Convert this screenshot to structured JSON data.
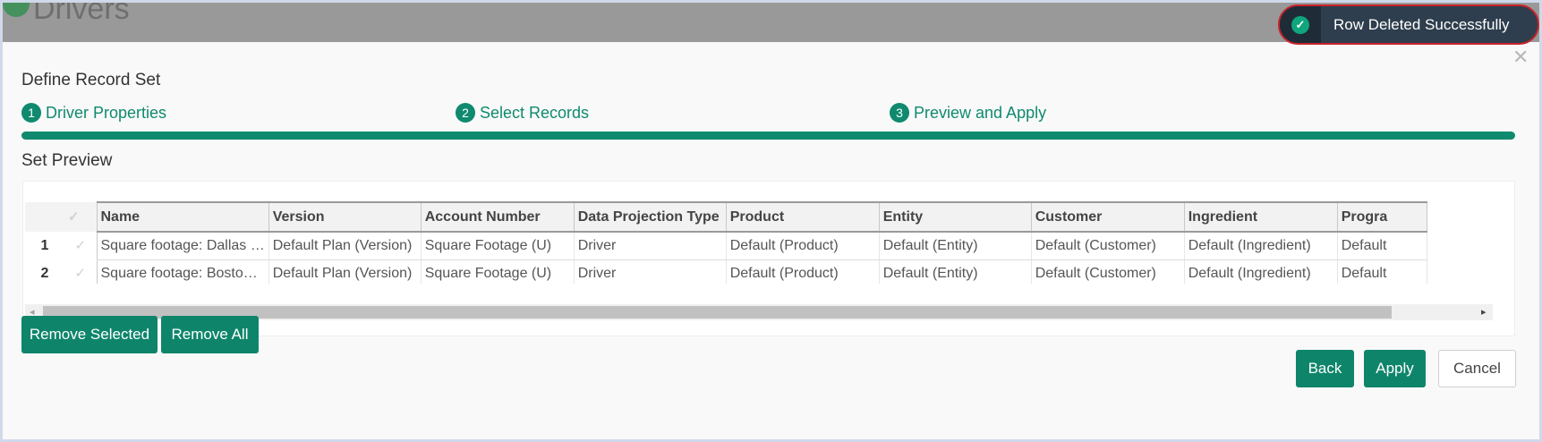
{
  "background": {
    "page_title": "Drivers"
  },
  "dialog": {
    "title": "Define Record Set",
    "close_glyph": "✕",
    "steps": [
      {
        "number": "1",
        "label": "Driver Properties"
      },
      {
        "number": "2",
        "label": "Select Records"
      },
      {
        "number": "3",
        "label": "Preview and Apply"
      }
    ],
    "progress_fraction": 1.0,
    "section_title": "Set Preview",
    "table": {
      "columns": [
        "Name",
        "Version",
        "Account Number",
        "Data Projection Type",
        "Product",
        "Entity",
        "Customer",
        "Ingredient",
        "Progra"
      ],
      "rows": [
        {
          "row_number": "1",
          "cells": [
            "Square footage: Dallas …",
            "Default Plan (Version)",
            "Square Footage (U)",
            "Driver",
            "Default (Product)",
            "Default (Entity)",
            "Default (Customer)",
            "Default (Ingredient)",
            "Default"
          ]
        },
        {
          "row_number": "2",
          "cells": [
            "Square footage: Bosto…",
            "Default Plan (Version)",
            "Square Footage (U)",
            "Driver",
            "Default (Product)",
            "Default (Entity)",
            "Default (Customer)",
            "Default (Ingredient)",
            "Default"
          ]
        }
      ],
      "check_glyph": "✓"
    },
    "scrollbar": {
      "left_arrow": "◂",
      "right_arrow": "▸"
    },
    "buttons": {
      "remove_selected": "Remove Selected",
      "remove_all": "Remove All",
      "back": "Back",
      "apply": "Apply",
      "cancel": "Cancel"
    }
  },
  "toast": {
    "message": "Row Deleted Successfully",
    "icon": "check-circle-icon",
    "icon_glyph": "✓"
  },
  "colors": {
    "accent": "#0f8a6f",
    "toast_bg": "#2f3e4e",
    "toast_outline": "#c8232a"
  }
}
